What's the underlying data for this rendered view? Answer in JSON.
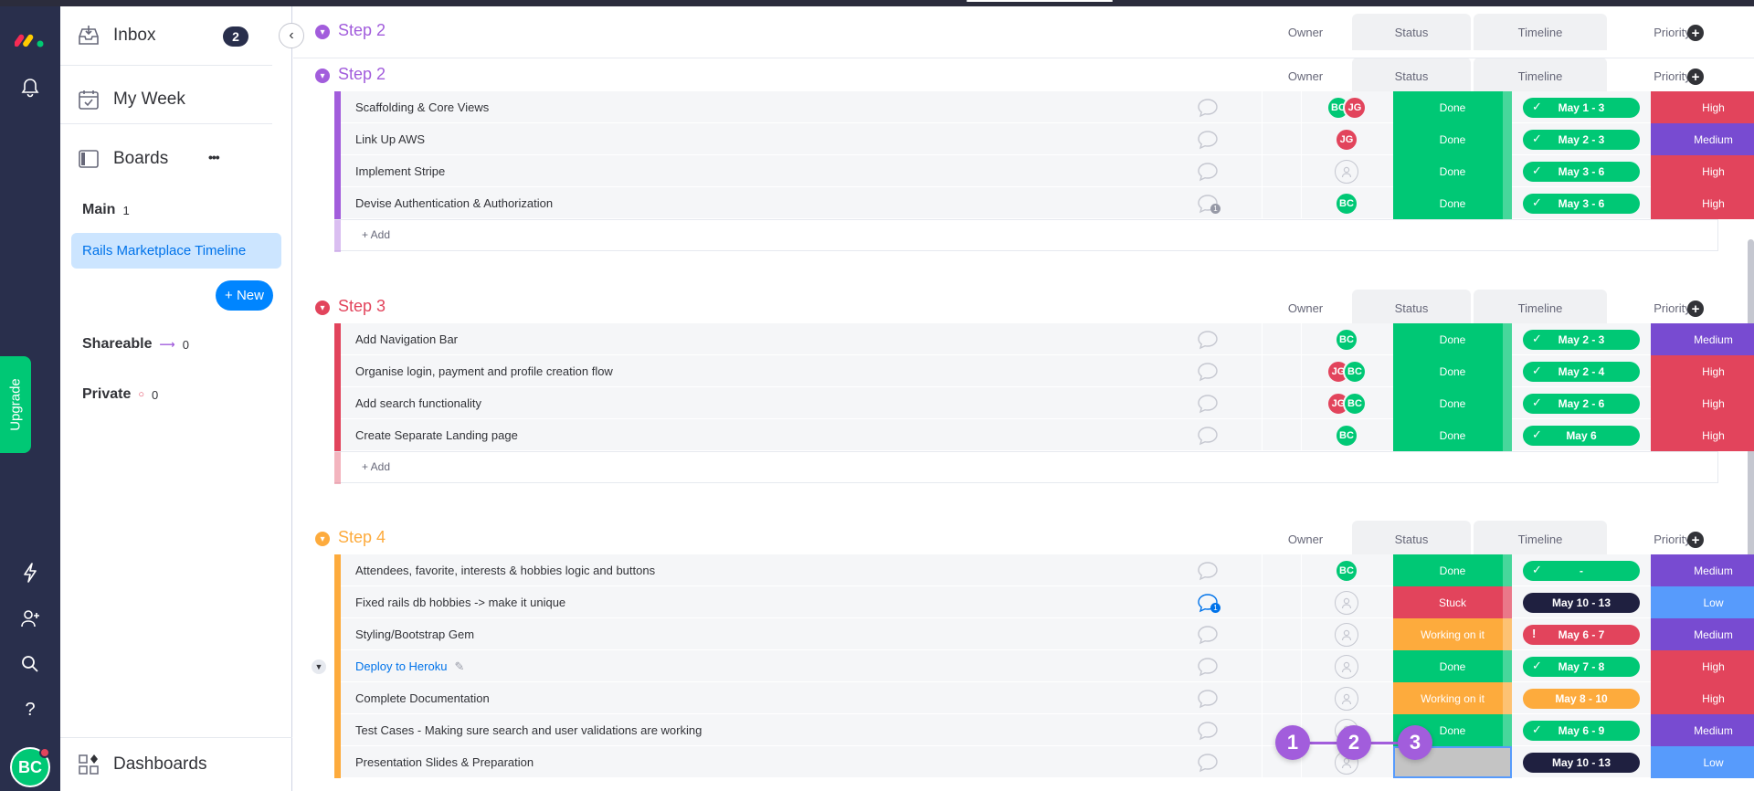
{
  "colors": {
    "done": "#00c875",
    "stuck": "#e2445c",
    "working": "#fdab3d",
    "empty": "#c4c4c4",
    "high": "#e2445c",
    "medium": "#784bd1",
    "low": "#579bfc",
    "step2": "#a25ddc",
    "step3": "#e2445c",
    "step4": "#fdab3d",
    "tl_done": "#00c875",
    "tl_dark": "#1f2040",
    "tl_warn": "#e2445c",
    "tl_orange": "#fdab3d"
  },
  "rail": {
    "icons": [
      "monday-logo-icon",
      "bell-icon",
      "lightning-icon",
      "add-user-icon",
      "search-icon",
      "help-icon"
    ],
    "upgrade_label": "Upgrade",
    "avatar": "BC"
  },
  "panel": {
    "inbox_label": "Inbox",
    "inbox_count": "2",
    "my_week_label": "My Week",
    "boards_label": "Boards",
    "boards_more": "•••",
    "main_label": "Main",
    "main_count": "1",
    "board_item": "Rails Marketplace Timeline",
    "new_label": "+ New",
    "shareable_label": "Shareable",
    "shareable_count": "0",
    "private_label": "Private",
    "private_count": "0",
    "dashboards_label": "Dashboards"
  },
  "columns": {
    "owner": "Owner",
    "status": "Status",
    "timeline": "Timeline",
    "priority": "Priority"
  },
  "add_label": "+ Add",
  "groups": [
    {
      "title": "Step 2",
      "color_key": "step2",
      "rows": [
        {
          "name": "Scaffolding & Core Views",
          "owners": [
            "BC",
            "JG"
          ],
          "status": "Done",
          "status_key": "done",
          "timeline": "May 1 - 3",
          "tl_key": "tl_done",
          "tl_icon": "check",
          "priority": "High",
          "priority_key": "high"
        },
        {
          "name": "Link Up AWS",
          "owners": [
            "JG"
          ],
          "status": "Done",
          "status_key": "done",
          "timeline": "May 2 - 3",
          "tl_key": "tl_done",
          "tl_icon": "check",
          "priority": "Medium",
          "priority_key": "medium"
        },
        {
          "name": "Implement Stripe",
          "owners": [],
          "status": "Done",
          "status_key": "done",
          "timeline": "May 3 - 6",
          "tl_key": "tl_done",
          "tl_icon": "check",
          "priority": "High",
          "priority_key": "high"
        },
        {
          "name": "Devise Authentication & Authorization",
          "owners": [
            "BC"
          ],
          "status": "Done",
          "status_key": "done",
          "timeline": "May 3 - 6",
          "tl_key": "tl_done",
          "tl_icon": "check",
          "priority": "High",
          "priority_key": "high",
          "chat_count": "1",
          "chat_grey": true
        }
      ]
    },
    {
      "title": "Step 3",
      "color_key": "step3",
      "rows": [
        {
          "name": "Add Navigation Bar",
          "owners": [
            "BC"
          ],
          "status": "Done",
          "status_key": "done",
          "timeline": "May 2 - 3",
          "tl_key": "tl_done",
          "tl_icon": "check",
          "priority": "Medium",
          "priority_key": "medium"
        },
        {
          "name": "Organise login, payment and profile creation flow",
          "owners": [
            "JG",
            "BC"
          ],
          "status": "Done",
          "status_key": "done",
          "timeline": "May 2 - 4",
          "tl_key": "tl_done",
          "tl_icon": "check",
          "priority": "High",
          "priority_key": "high"
        },
        {
          "name": "Add search functionality",
          "owners": [
            "JG",
            "BC"
          ],
          "status": "Done",
          "status_key": "done",
          "timeline": "May 2 - 6",
          "tl_key": "tl_done",
          "tl_icon": "check",
          "priority": "High",
          "priority_key": "high"
        },
        {
          "name": "Create Separate Landing page",
          "owners": [
            "BC"
          ],
          "status": "Done",
          "status_key": "done",
          "timeline": "May 6",
          "tl_key": "tl_done",
          "tl_icon": "check",
          "priority": "High",
          "priority_key": "high"
        }
      ]
    },
    {
      "title": "Step 4",
      "color_key": "step4",
      "rows": [
        {
          "name": "Attendees, favorite, interests & hobbies logic and buttons",
          "owners": [
            "BC"
          ],
          "status": "Done",
          "status_key": "done",
          "timeline": "-",
          "tl_key": "tl_done",
          "tl_icon": "check",
          "priority": "Medium",
          "priority_key": "medium"
        },
        {
          "name": "Fixed rails db hobbies -> make it unique",
          "owners": [],
          "status": "Stuck",
          "status_key": "stuck",
          "timeline": "May 10 - 13",
          "tl_key": "tl_dark",
          "tl_icon": "",
          "priority": "Low",
          "priority_key": "low",
          "chat_count": "1"
        },
        {
          "name": "Styling/Bootstrap Gem",
          "owners": [],
          "status": "Working on it",
          "status_key": "working",
          "timeline": "May 6 - 7",
          "tl_key": "tl_warn",
          "tl_icon": "warn",
          "priority": "Medium",
          "priority_key": "medium"
        },
        {
          "name": "Deploy to Heroku",
          "owners": [],
          "status": "Done",
          "status_key": "done",
          "timeline": "May 7 - 8",
          "tl_key": "tl_done",
          "tl_icon": "check",
          "priority": "High",
          "priority_key": "high",
          "link": true
        },
        {
          "name": "Complete Documentation",
          "owners": [],
          "status": "Working on it",
          "status_key": "working",
          "timeline": "May 8 - 10",
          "tl_key": "tl_orange",
          "tl_icon": "",
          "priority": "High",
          "priority_key": "high"
        },
        {
          "name": "Test Cases - Making sure search and user validations are working",
          "owners": [],
          "status": "Done",
          "status_key": "done",
          "timeline": "May 6 - 9",
          "tl_key": "tl_done",
          "tl_icon": "check",
          "priority": "Medium",
          "priority_key": "medium"
        },
        {
          "name": "Presentation Slides & Preparation",
          "owners": [],
          "status": "",
          "status_key": "empty",
          "timeline": "May 10 - 13",
          "tl_key": "tl_dark",
          "tl_icon": "",
          "priority": "Low",
          "priority_key": "low"
        }
      ]
    }
  ],
  "sticky_group_title": "Step 2",
  "floating_steps": [
    "1",
    "2",
    "3"
  ]
}
